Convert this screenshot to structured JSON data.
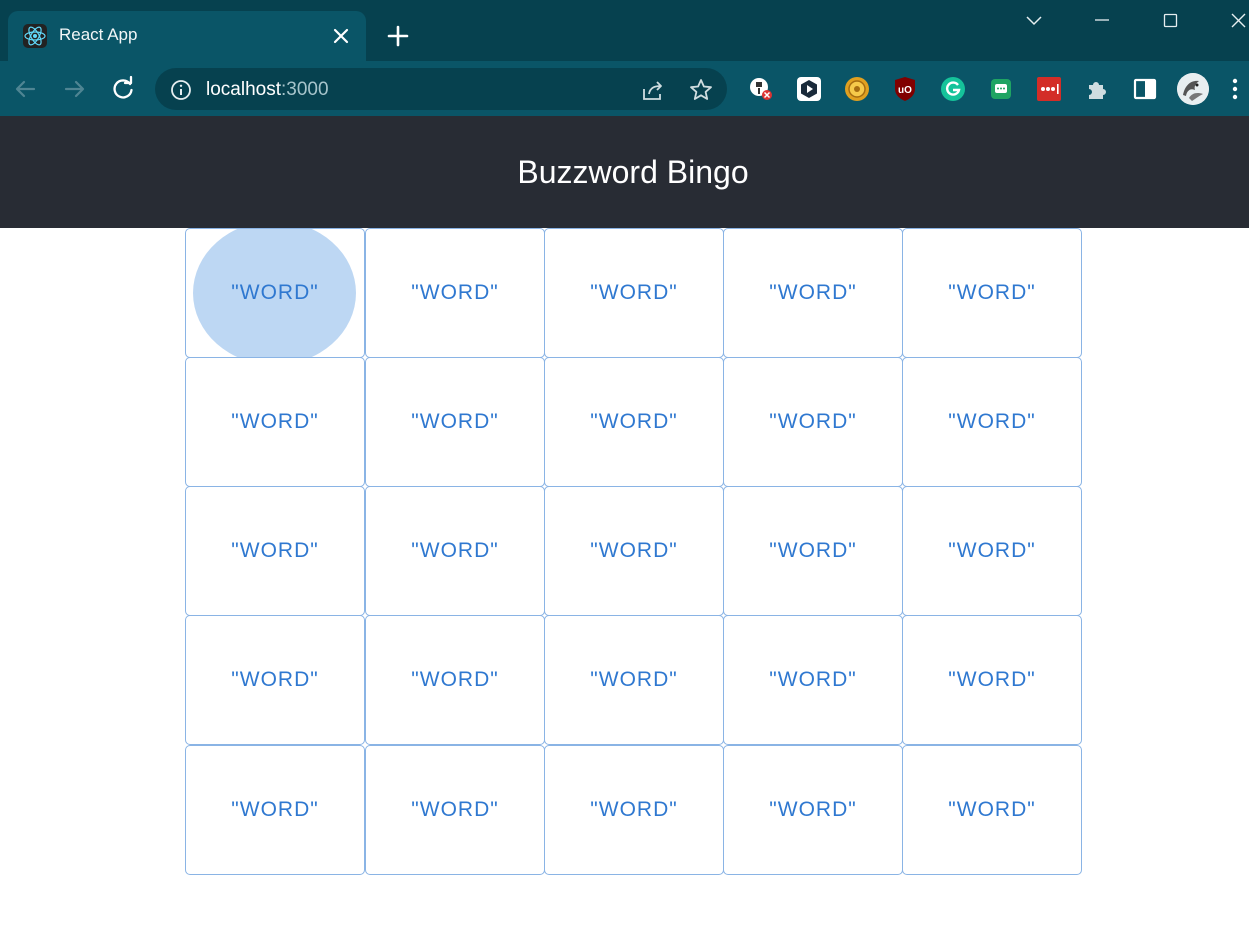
{
  "browser": {
    "tab_title": "React App",
    "url_host": "localhost",
    "url_port": ":3000",
    "icons": {
      "back": "arrow-left-icon",
      "forward": "arrow-right-icon",
      "reload": "reload-icon",
      "site_info": "info-icon",
      "share": "share-icon",
      "bookmark": "star-icon"
    },
    "extensions": [
      "blocker-extension-icon",
      "play-extension-icon",
      "coin-extension-icon",
      "ublock-extension-icon",
      "grammarly-extension-icon",
      "chat-extension-icon",
      "password-extension-icon",
      "puzzle-extensions-icon",
      "side-panel-icon"
    ],
    "colors": {
      "frame": "#06414f",
      "toolbar": "#0a5567"
    }
  },
  "app": {
    "title": "Buzzword Bingo",
    "colors": {
      "header": "#282c34",
      "cell_text": "#2f78d0",
      "cell_border": "#8ab4e5",
      "ripple": "#bdd7f3"
    },
    "pressed_cell": 0,
    "cells": [
      "\"WORD\"",
      "\"WORD\"",
      "\"WORD\"",
      "\"WORD\"",
      "\"WORD\"",
      "\"WORD\"",
      "\"WORD\"",
      "\"WORD\"",
      "\"WORD\"",
      "\"WORD\"",
      "\"WORD\"",
      "\"WORD\"",
      "\"WORD\"",
      "\"WORD\"",
      "\"WORD\"",
      "\"WORD\"",
      "\"WORD\"",
      "\"WORD\"",
      "\"WORD\"",
      "\"WORD\"",
      "\"WORD\"",
      "\"WORD\"",
      "\"WORD\"",
      "\"WORD\"",
      "\"WORD\""
    ]
  }
}
